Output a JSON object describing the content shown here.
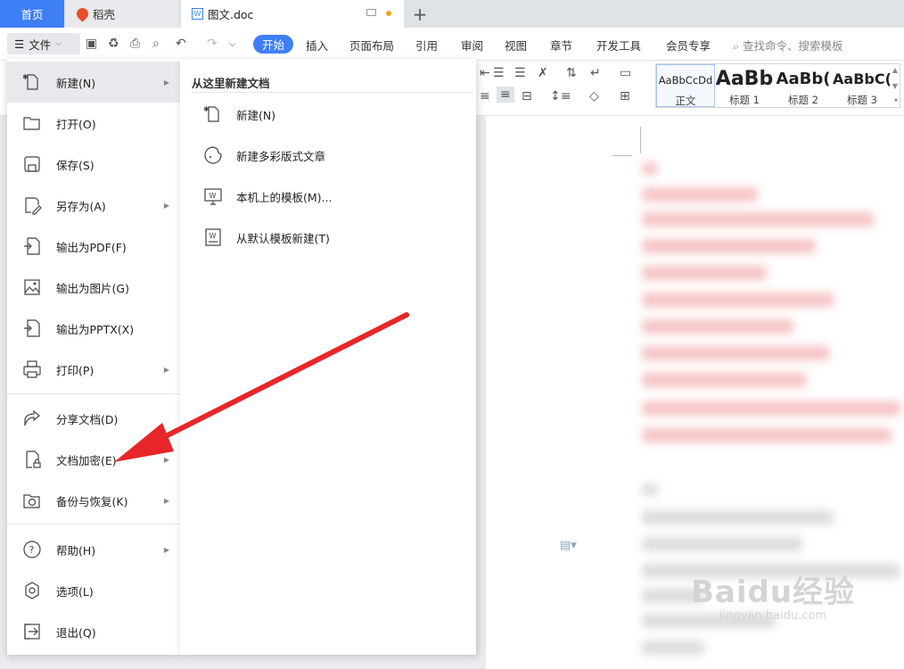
{
  "tabs": {
    "home": "首页",
    "daoke": "稻壳",
    "doc": "图文.doc",
    "doc_badge": "W",
    "add": "+"
  },
  "menubar": {
    "file": "文件",
    "tabs": [
      "开始",
      "插入",
      "页面布局",
      "引用",
      "审阅",
      "视图",
      "章节",
      "开发工具",
      "会员专享"
    ],
    "search": "查找命令、搜索模板"
  },
  "ribbon": {
    "styles": [
      {
        "sample": "AaBbCcDd",
        "name": "正文"
      },
      {
        "sample": "AaBb",
        "name": "标题 1"
      },
      {
        "sample": "AaBb(",
        "name": "标题 2"
      },
      {
        "sample": "AaBbC(",
        "name": "标题 3"
      }
    ]
  },
  "file_menu": {
    "items": [
      {
        "label": "新建(N)",
        "icon": "new-doc-icon",
        "submenu": true,
        "active": true
      },
      {
        "label": "打开(O)",
        "icon": "folder-open-icon",
        "submenu": false
      },
      {
        "label": "保存(S)",
        "icon": "save-icon",
        "submenu": false
      },
      {
        "label": "另存为(A)",
        "icon": "save-as-icon",
        "submenu": true
      },
      {
        "label": "输出为PDF(F)",
        "icon": "export-pdf-icon",
        "submenu": false
      },
      {
        "label": "输出为图片(G)",
        "icon": "export-image-icon",
        "submenu": false
      },
      {
        "label": "输出为PPTX(X)",
        "icon": "export-pptx-icon",
        "submenu": false
      },
      {
        "label": "打印(P)",
        "icon": "print-icon",
        "submenu": true
      },
      {
        "label": "分享文档(D)",
        "icon": "share-icon",
        "submenu": false
      },
      {
        "label": "文档加密(E)",
        "icon": "encrypt-icon",
        "submenu": true
      },
      {
        "label": "备份与恢复(K)",
        "icon": "backup-icon",
        "submenu": true
      },
      {
        "label": "帮助(H)",
        "icon": "help-icon",
        "submenu": true
      },
      {
        "label": "选项(L)",
        "icon": "settings-icon",
        "submenu": false
      },
      {
        "label": "退出(Q)",
        "icon": "exit-icon",
        "submenu": false
      }
    ]
  },
  "submenu": {
    "heading": "从这里新建文档",
    "items": [
      {
        "label": "新建(N)",
        "icon": "new-doc-icon"
      },
      {
        "label": "新建多彩版式文章",
        "icon": "colorful-article-icon"
      },
      {
        "label": "本机上的模板(M)...",
        "icon": "local-template-icon"
      },
      {
        "label": "从默认模板新建(T)",
        "icon": "default-template-icon"
      }
    ]
  },
  "watermark": {
    "main": "Baidu经验",
    "url": "jingyan.baidu.com"
  },
  "colors": {
    "accent": "#3f7ff5",
    "arrow": "#e8262a"
  }
}
